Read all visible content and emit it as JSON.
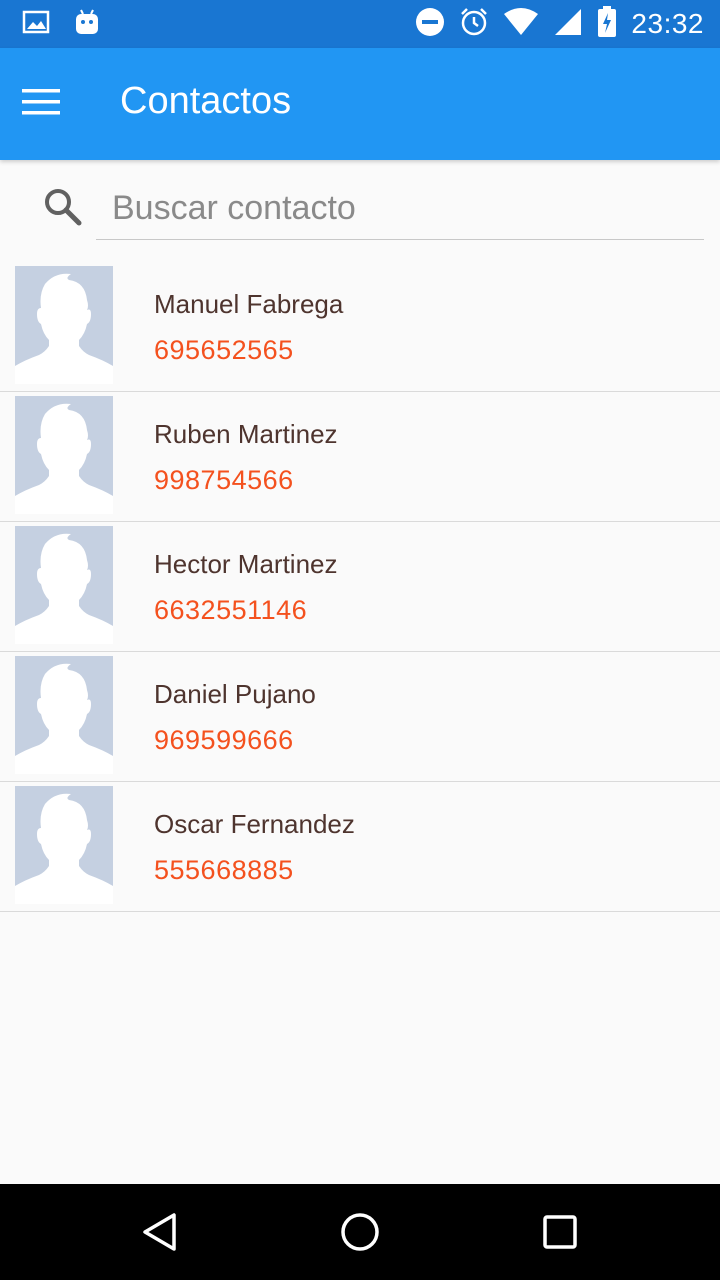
{
  "status_bar": {
    "time": "23:32",
    "icons_left": [
      "image-icon",
      "android-icon"
    ],
    "icons_right": [
      "dnd-icon",
      "alarm-icon",
      "wifi-icon",
      "signal-icon",
      "battery-charging-icon"
    ]
  },
  "app_bar": {
    "title": "Contactos",
    "menu_icon": "hamburger-menu-icon"
  },
  "search": {
    "placeholder": "Buscar contacto",
    "value": ""
  },
  "contacts": [
    {
      "name": "Manuel Fabrega",
      "phone": "695652565"
    },
    {
      "name": "Ruben Martinez",
      "phone": "998754566"
    },
    {
      "name": "Hector Martinez",
      "phone": "6632551146"
    },
    {
      "name": "Daniel Pujano",
      "phone": "969599666"
    },
    {
      "name": "Oscar Fernandez",
      "phone": "555668885"
    }
  ],
  "nav_bar": {
    "buttons": [
      "back-icon",
      "home-icon",
      "recents-icon"
    ]
  },
  "colors": {
    "status_bar": "#1976d2",
    "app_bar": "#2196f3",
    "name_text": "#4e342e",
    "phone_text": "#f4511e",
    "avatar_bg": "#c5d0e1"
  }
}
